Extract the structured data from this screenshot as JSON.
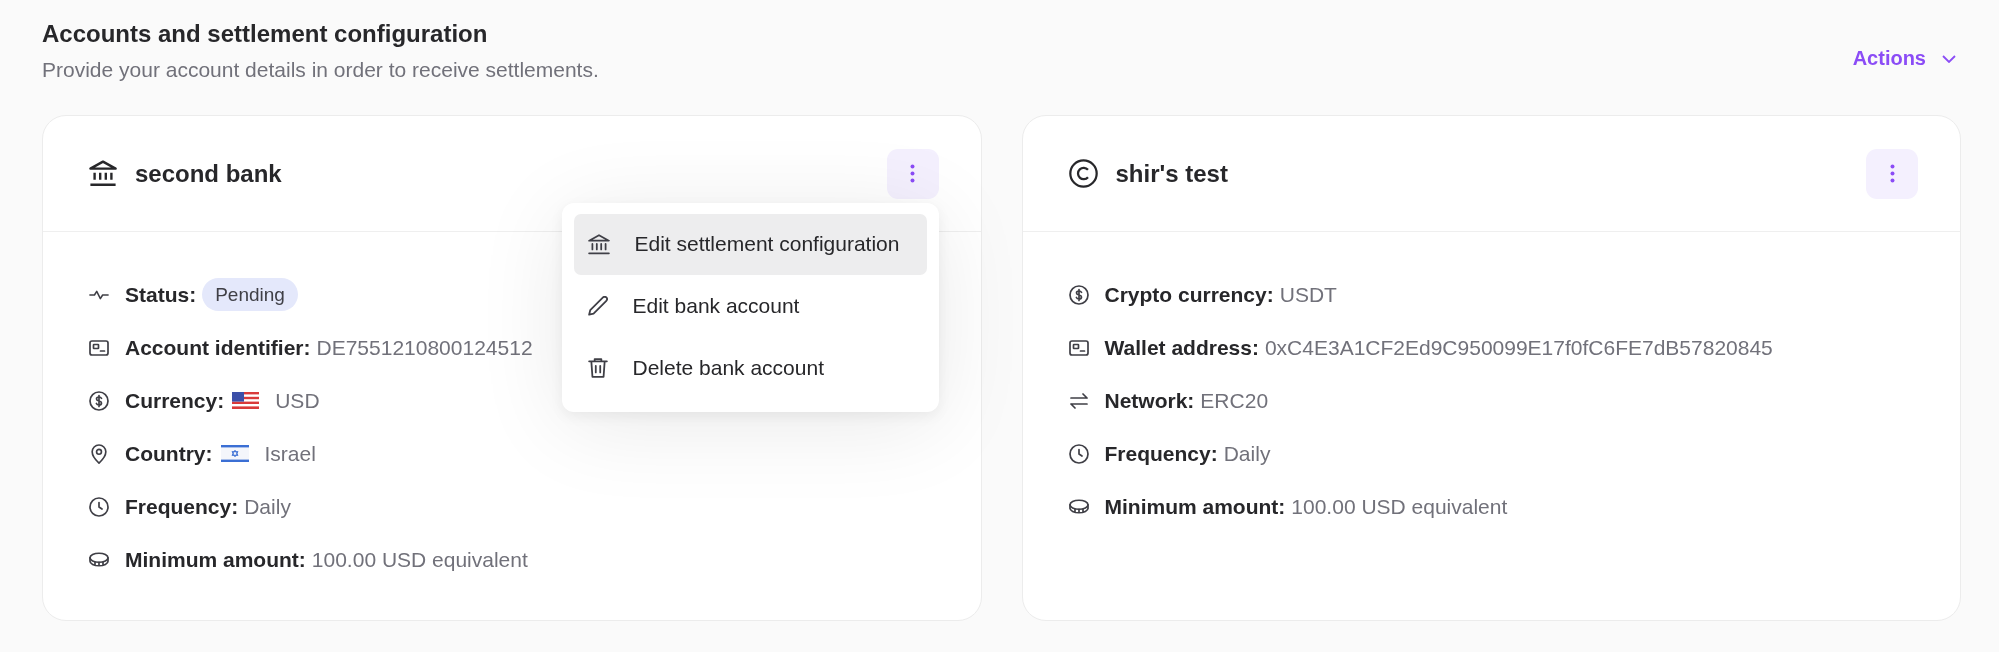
{
  "header": {
    "title": "Accounts and settlement configuration",
    "subtitle": "Provide your account details in order to receive settlements.",
    "actions": {
      "label": "Actions"
    }
  },
  "cards": [
    {
      "kind": "bank",
      "title": "second bank",
      "menu_open": true,
      "fields": [
        {
          "kind": "status",
          "label": "Status:",
          "badge": "Pending"
        },
        {
          "kind": "account",
          "label": "Account identifier:",
          "value": "DE7551210800124512"
        },
        {
          "kind": "currency",
          "label": "Currency:",
          "value": "USD"
        },
        {
          "kind": "country",
          "label": "Country:",
          "value": "Israel"
        },
        {
          "kind": "frequency",
          "label": "Frequency:",
          "value": "Daily"
        },
        {
          "kind": "minimum",
          "label": "Minimum amount:",
          "value": "100.00 USD equivalent"
        }
      ],
      "menu": [
        {
          "kind": "settlement",
          "label": "Edit settlement configuration",
          "selected": true
        },
        {
          "kind": "edit",
          "label": "Edit bank account",
          "selected": false
        },
        {
          "kind": "delete",
          "label": "Delete bank account",
          "selected": false
        }
      ]
    },
    {
      "kind": "crypto",
      "title": "shir's test",
      "fields": [
        {
          "kind": "crypto",
          "label": "Crypto currency:",
          "value": "USDT"
        },
        {
          "kind": "wallet",
          "label": "Wallet address:",
          "value": "0xC4E3A1CF2Ed9C950099E17f0fC6FE7dB57820845"
        },
        {
          "kind": "network",
          "label": "Network:",
          "value": "ERC20"
        },
        {
          "kind": "frequency",
          "label": "Frequency:",
          "value": "Daily"
        },
        {
          "kind": "minimum",
          "label": "Minimum amount:",
          "value": "100.00 USD equivalent"
        }
      ]
    }
  ]
}
